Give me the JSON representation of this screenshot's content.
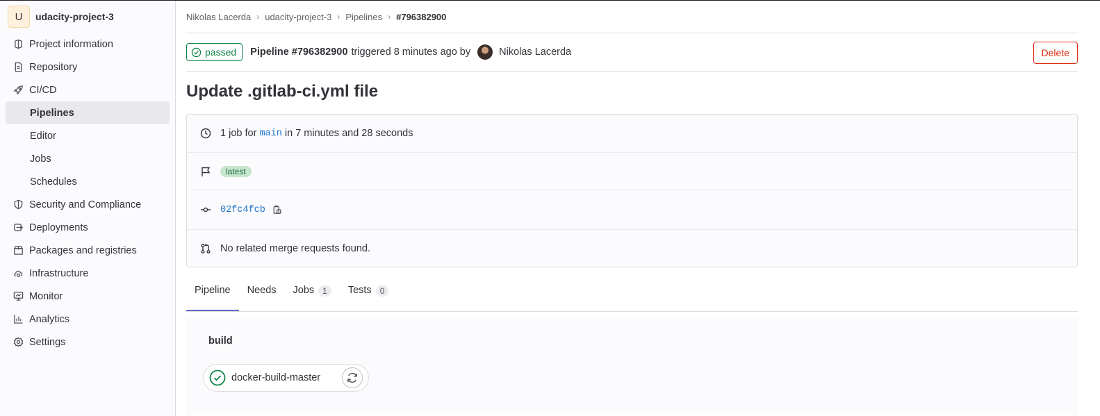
{
  "project": {
    "avatar_letter": "U",
    "name": "udacity-project-3"
  },
  "sidebar": {
    "items": [
      {
        "label": "Project information",
        "icon": "project-icon"
      },
      {
        "label": "Repository",
        "icon": "document-icon"
      },
      {
        "label": "CI/CD",
        "icon": "rocket-icon"
      },
      {
        "label": "Pipelines",
        "sub": true,
        "active": true
      },
      {
        "label": "Editor",
        "sub": true
      },
      {
        "label": "Jobs",
        "sub": true
      },
      {
        "label": "Schedules",
        "sub": true
      },
      {
        "label": "Security and Compliance",
        "icon": "shield-icon"
      },
      {
        "label": "Deployments",
        "icon": "deployments-icon"
      },
      {
        "label": "Packages and registries",
        "icon": "package-icon"
      },
      {
        "label": "Infrastructure",
        "icon": "cloud-gear-icon"
      },
      {
        "label": "Monitor",
        "icon": "monitor-icon"
      },
      {
        "label": "Analytics",
        "icon": "chart-icon"
      },
      {
        "label": "Settings",
        "icon": "settings-icon"
      }
    ]
  },
  "breadcrumb": {
    "items": [
      "Nikolas Lacerda",
      "udacity-project-3",
      "Pipelines"
    ],
    "current": "#796382900"
  },
  "pipeline": {
    "status": "passed",
    "title": "Pipeline #796382900",
    "meta": "triggered 8 minutes ago by",
    "user": "Nikolas Lacerda",
    "delete_label": "Delete",
    "commit_title": "Update .gitlab-ci.yml file"
  },
  "info": {
    "jobs_prefix": "1 job for",
    "branch": "main",
    "duration": "in 7 minutes and 28 seconds",
    "tag": "latest",
    "commit_sha": "02fc4fcb",
    "merge_requests": "No related merge requests found."
  },
  "tabs": [
    {
      "label": "Pipeline"
    },
    {
      "label": "Needs"
    },
    {
      "label": "Jobs",
      "count": "1"
    },
    {
      "label": "Tests",
      "count": "0"
    }
  ],
  "graph": {
    "stage": "build",
    "job": "docker-build-master"
  },
  "colors": {
    "success": "#108548",
    "danger": "#dd2b0e",
    "link": "#1f75cb",
    "tab_active": "#6666c4"
  }
}
